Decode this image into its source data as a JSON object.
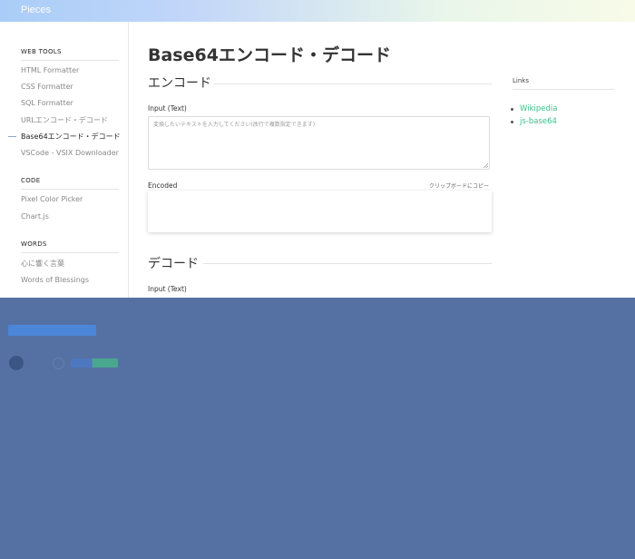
{
  "app": {
    "brand": "Pieces"
  },
  "sidebar": {
    "sections": [
      {
        "title": "WEB TOOLS",
        "items": [
          {
            "label": "HTML Formatter"
          },
          {
            "label": "CSS Formatter"
          },
          {
            "label": "SQL Formatter"
          },
          {
            "label": "URLエンコード・デコード"
          },
          {
            "label": "Base64エンコード・デコード",
            "active": true
          },
          {
            "label": "VSCode - VSIX Downloader"
          }
        ]
      },
      {
        "title": "CODE",
        "items": [
          {
            "label": "Pixel Color Picker"
          },
          {
            "label": "Chart.js"
          }
        ]
      },
      {
        "title": "WORDS",
        "items": [
          {
            "label": "心に響く言葉"
          },
          {
            "label": "Words of Blessings"
          }
        ]
      }
    ]
  },
  "main": {
    "title": "Base64エンコード・デコード",
    "encode": {
      "heading": "エンコード",
      "input_label": "Input (Text)",
      "input_placeholder": "変換したいテキストを入力してください(改行で複数指定できます)",
      "output_label": "Encoded",
      "copy_label": "クリップボードにコピー"
    },
    "decode": {
      "heading": "デコード",
      "input_label": "Input (Text)"
    }
  },
  "links": {
    "title": "Links",
    "items": [
      {
        "label": "Wikipedia"
      },
      {
        "label": "js-base64"
      }
    ]
  },
  "overlay": {
    "color": "#5571a3"
  },
  "colors": {
    "accent_green": "#3bbf8a",
    "overlay": "#5571a3"
  }
}
